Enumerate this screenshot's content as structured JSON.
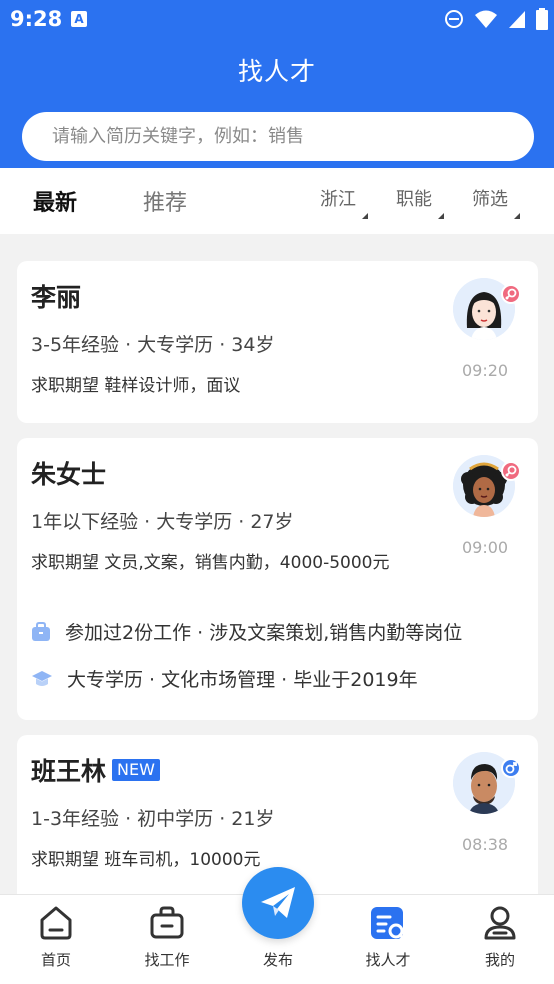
{
  "status_bar": {
    "time": "9:28",
    "notif_icon": "A"
  },
  "header": {
    "title": "找人才"
  },
  "search": {
    "placeholder": "请输入简历关键字，例如：销售"
  },
  "tabs": [
    {
      "label": "最新",
      "active": true
    },
    {
      "label": "推荐",
      "active": false
    }
  ],
  "filters": {
    "region": "浙江",
    "function": "职能",
    "filter": "筛选"
  },
  "cards": [
    {
      "name": "李丽",
      "gender": "female",
      "meta": "3-5年经验 · 大专学历 · 34岁",
      "expect": "求职期望 鞋样设计师，面议",
      "time": "09:20"
    },
    {
      "name": "朱女士",
      "gender": "female",
      "meta": "1年以下经验 · 大专学历 · 27岁",
      "expect": "求职期望 文员,文案，销售内勤，4000-5000元",
      "time": "09:00",
      "work": "参加过2份工作 · 涉及文案策划,销售内勤等岗位",
      "edu": "大专学历 · 文化市场管理 · 毕业于2019年"
    },
    {
      "name": "班王林",
      "badge": "NEW",
      "gender": "male",
      "meta": "1-3年经验 · 初中学历 · 21岁",
      "expect": "求职期望 班车司机，10000元",
      "time": "08:38"
    }
  ],
  "nav": {
    "home": "首页",
    "jobs": "找工作",
    "post": "发布",
    "talent": "找人才",
    "mine": "我的"
  },
  "colors": {
    "primary": "#2b72f0",
    "female": "#f06a7f",
    "male": "#3d7ef0"
  }
}
